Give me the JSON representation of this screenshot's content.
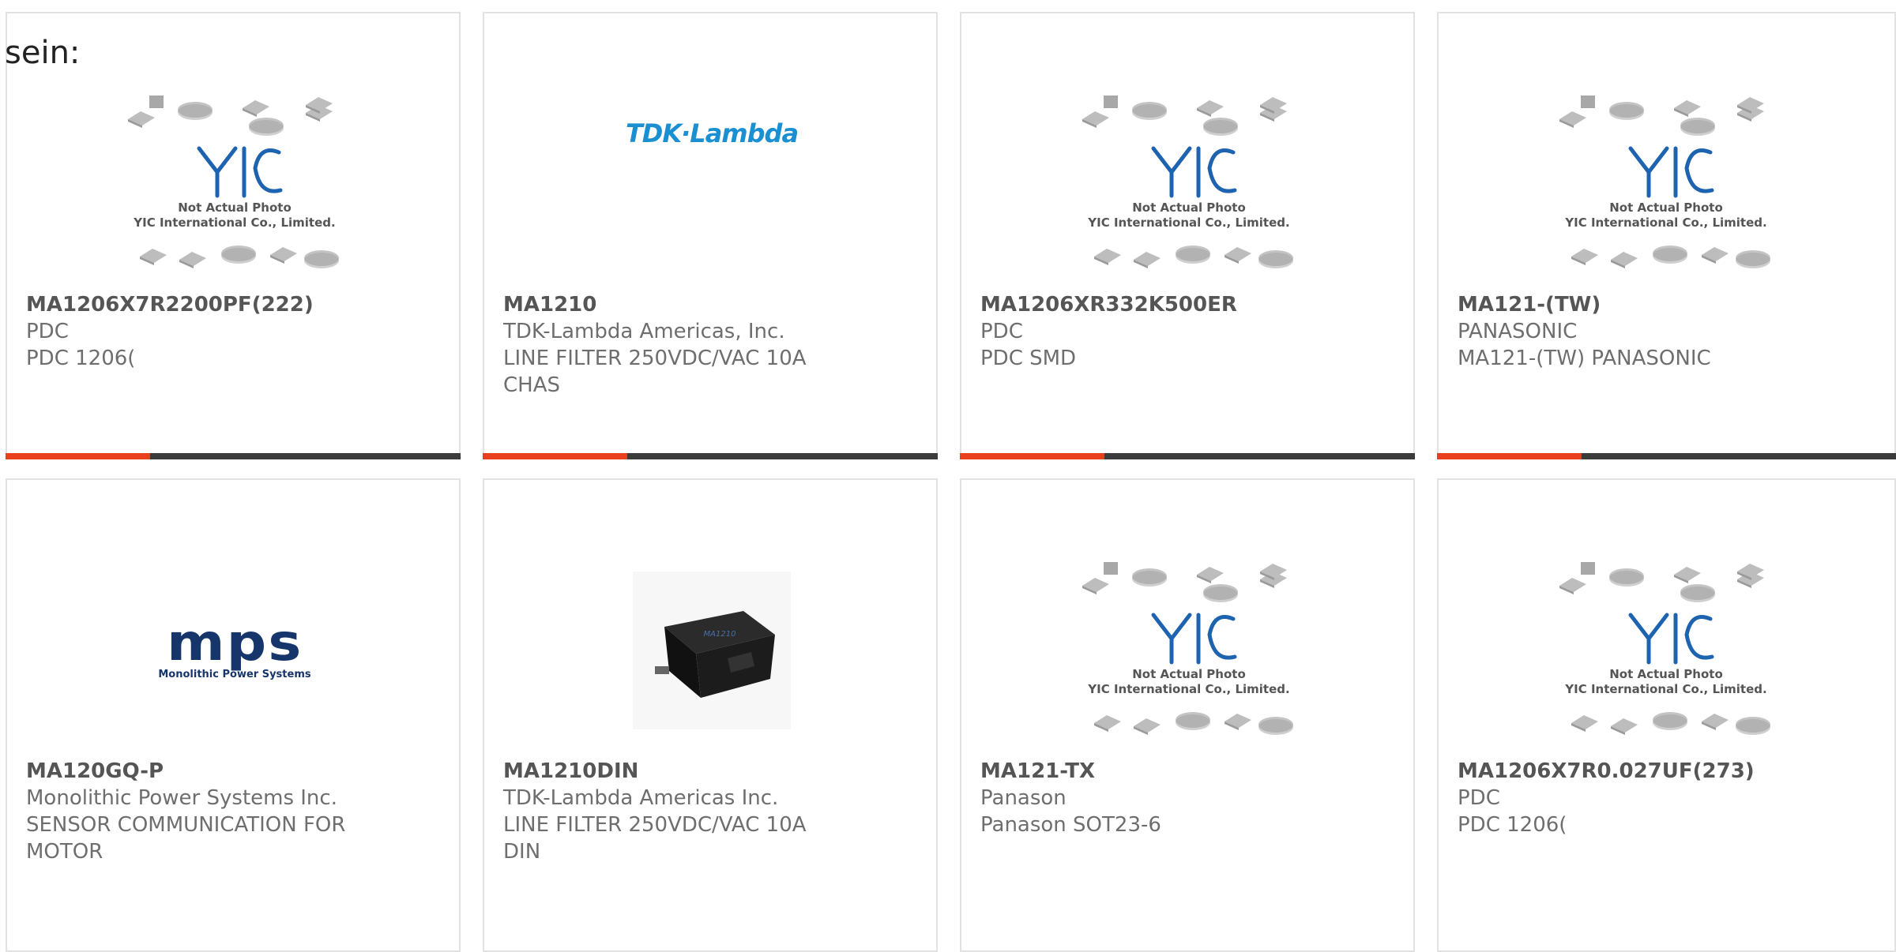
{
  "page": {
    "intro_fragment": "sein:"
  },
  "colors": {
    "accent": "#e8401c",
    "bar": "#3b3b3b",
    "yic_blue": "#1e63b0",
    "tdk_blue": "#1a8fd1",
    "mps_navy": "#16356a"
  },
  "placeholder": {
    "line1": "Not Actual Photo",
    "line2": "YIC International Co., Limited.",
    "brand": "YIC"
  },
  "products": [
    {
      "part": "MA1206X7R2200PF(222)",
      "manufacturer": "PDC",
      "description": "PDC 1206(",
      "image": "yic-placeholder"
    },
    {
      "part": "MA1210",
      "manufacturer": "TDK-Lambda Americas, Inc.",
      "description": "LINE FILTER 250VDC/VAC 10A CHAS",
      "image": "tdk-lambda-logo",
      "logo_text": "TDK·Lambda"
    },
    {
      "part": "MA1206XR332K500ER",
      "manufacturer": "PDC",
      "description": "PDC SMD",
      "image": "yic-placeholder"
    },
    {
      "part": "MA121-(TW)",
      "manufacturer": "PANASONIC",
      "description": "MA121-(TW) PANASONIC",
      "image": "yic-placeholder"
    },
    {
      "part": "MA120GQ-P",
      "manufacturer": "Monolithic Power Systems Inc.",
      "description": "SENSOR COMMUNICATION FOR MOTOR",
      "image": "mps-logo",
      "logo_text": "mps",
      "logo_sub": "Monolithic Power Systems"
    },
    {
      "part": "MA1210DIN",
      "manufacturer": "TDK-Lambda Americas Inc.",
      "description": "LINE FILTER 250VDC/VAC 10A DIN",
      "image": "line-filter-photo"
    },
    {
      "part": "MA121-TX",
      "manufacturer": "Panason",
      "description": "Panason SOT23-6",
      "image": "yic-placeholder"
    },
    {
      "part": "MA1206X7R0.027UF(273)",
      "manufacturer": "PDC",
      "description": "PDC 1206(",
      "image": "yic-placeholder"
    }
  ]
}
